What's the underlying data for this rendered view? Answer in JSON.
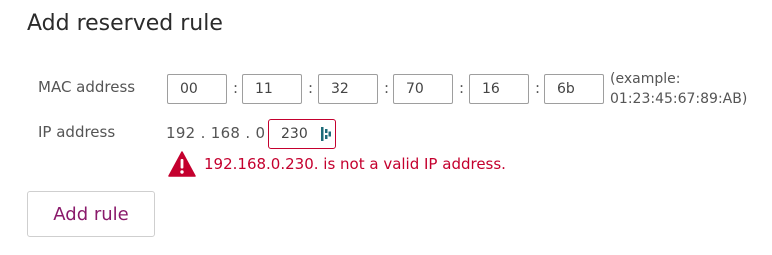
{
  "page": {
    "title": "Add reserved rule"
  },
  "mac": {
    "label": "MAC address",
    "octets": [
      "00",
      "11",
      "32",
      "70",
      "16",
      "6b"
    ],
    "separator": ":",
    "example_line1": "(example:",
    "example_line2": "01:23:45:67:89:AB)"
  },
  "ip": {
    "label": "IP address",
    "prefix": "192 . 168 . 0 .",
    "last_octet": "230"
  },
  "error": {
    "message": "192.168.0.230. is not a valid IP address.",
    "color": "#c4002e",
    "icon": "warning-triangle-icon"
  },
  "actions": {
    "add_rule_label": "Add rule",
    "button_text_color": "#8a1a6b"
  }
}
